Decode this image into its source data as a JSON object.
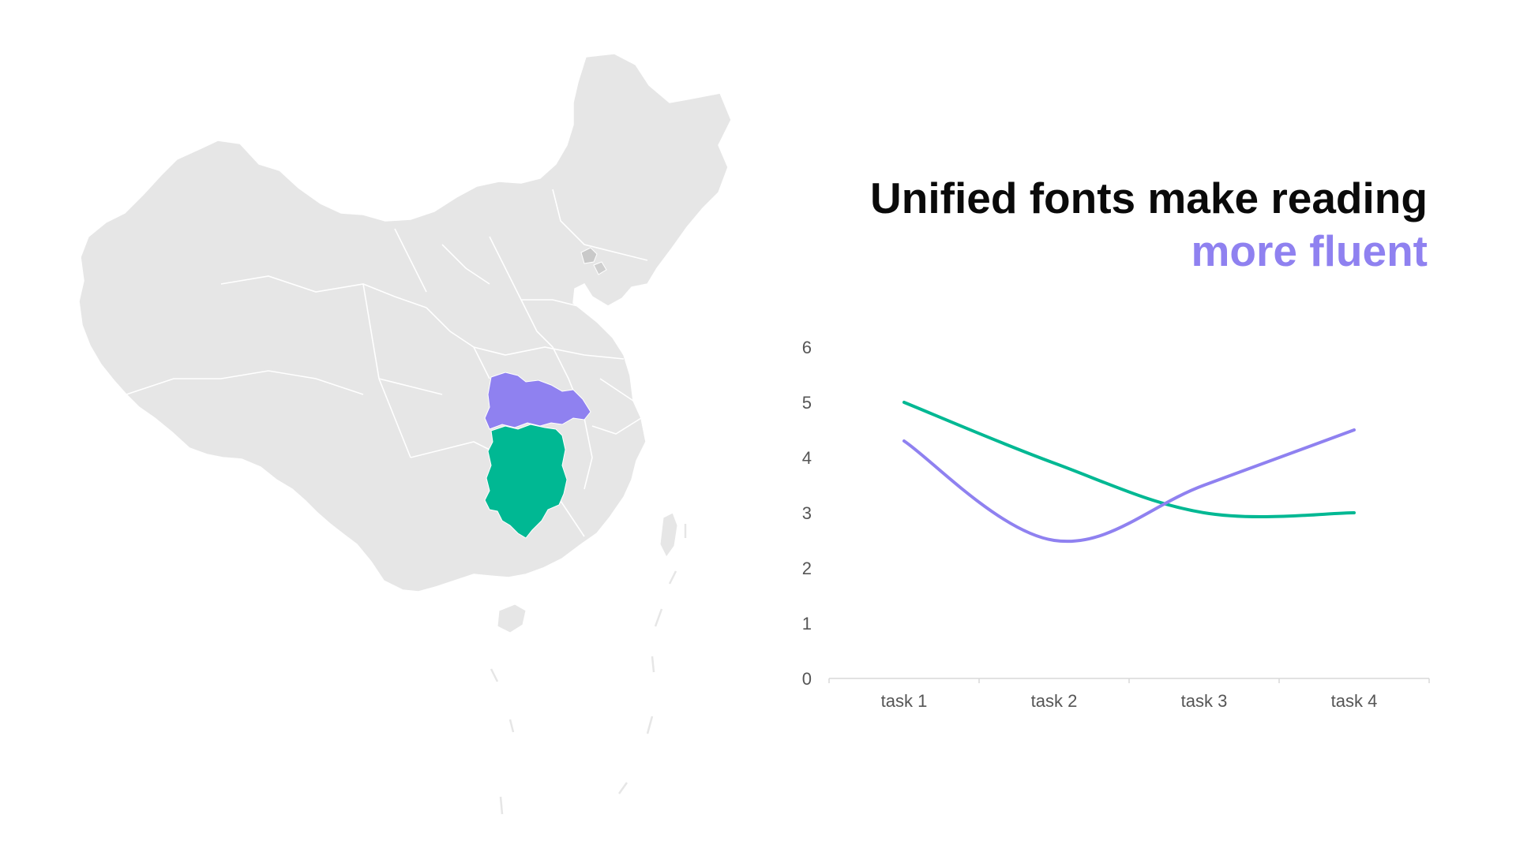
{
  "headline": {
    "line1": "Unified fonts make reading",
    "line2": "more fluent"
  },
  "colors": {
    "purple": "#8f81f0",
    "green": "#00b893",
    "map_land": "#e6e6e6",
    "map_border": "#ffffff",
    "axis": "#d9d9d9"
  },
  "map": {
    "highlighted_regions": [
      {
        "name": "Hubei",
        "color": "purple"
      },
      {
        "name": "Hunan",
        "color": "green"
      }
    ]
  },
  "chart_data": {
    "type": "line",
    "categories": [
      "task 1",
      "task  2",
      "task 3",
      "task  4"
    ],
    "series": [
      {
        "color": "#00b893",
        "values": [
          5,
          3.9,
          3.0,
          3.0
        ]
      },
      {
        "color": "#8f81f0",
        "values": [
          4.3,
          2.5,
          3.5,
          4.5
        ]
      }
    ],
    "ylim": [
      0,
      6
    ],
    "yticks": [
      0,
      1,
      2,
      3,
      4,
      5,
      6
    ],
    "smooth": true,
    "grid": false,
    "legend": "none"
  }
}
